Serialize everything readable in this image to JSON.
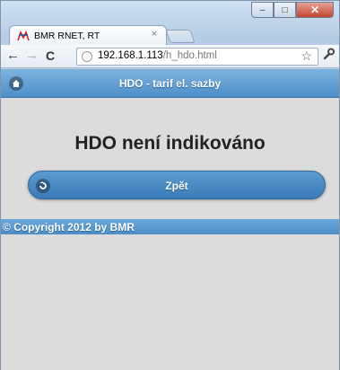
{
  "browser": {
    "tab_title": "BMR RNET, RT",
    "tab_close": "×",
    "url_host": "192.168.1.113",
    "url_path": "/h_hdo.html",
    "controls": {
      "minimize": "–",
      "maximize": "□",
      "close": "✕"
    }
  },
  "icons": {
    "back": "←",
    "forward": "→",
    "reload": "C",
    "star": "☆",
    "wrench": "🔧"
  },
  "page": {
    "header_title": "HDO - tarif el. sazby",
    "heading": "HDO není indikováno",
    "back_button_label": "Zpět",
    "footer": "© Copyright 2012 by BMR"
  },
  "colors": {
    "header_bar": "#4d8ec8",
    "button": "#3a7bb7",
    "page_background": "#dcdcdc"
  }
}
